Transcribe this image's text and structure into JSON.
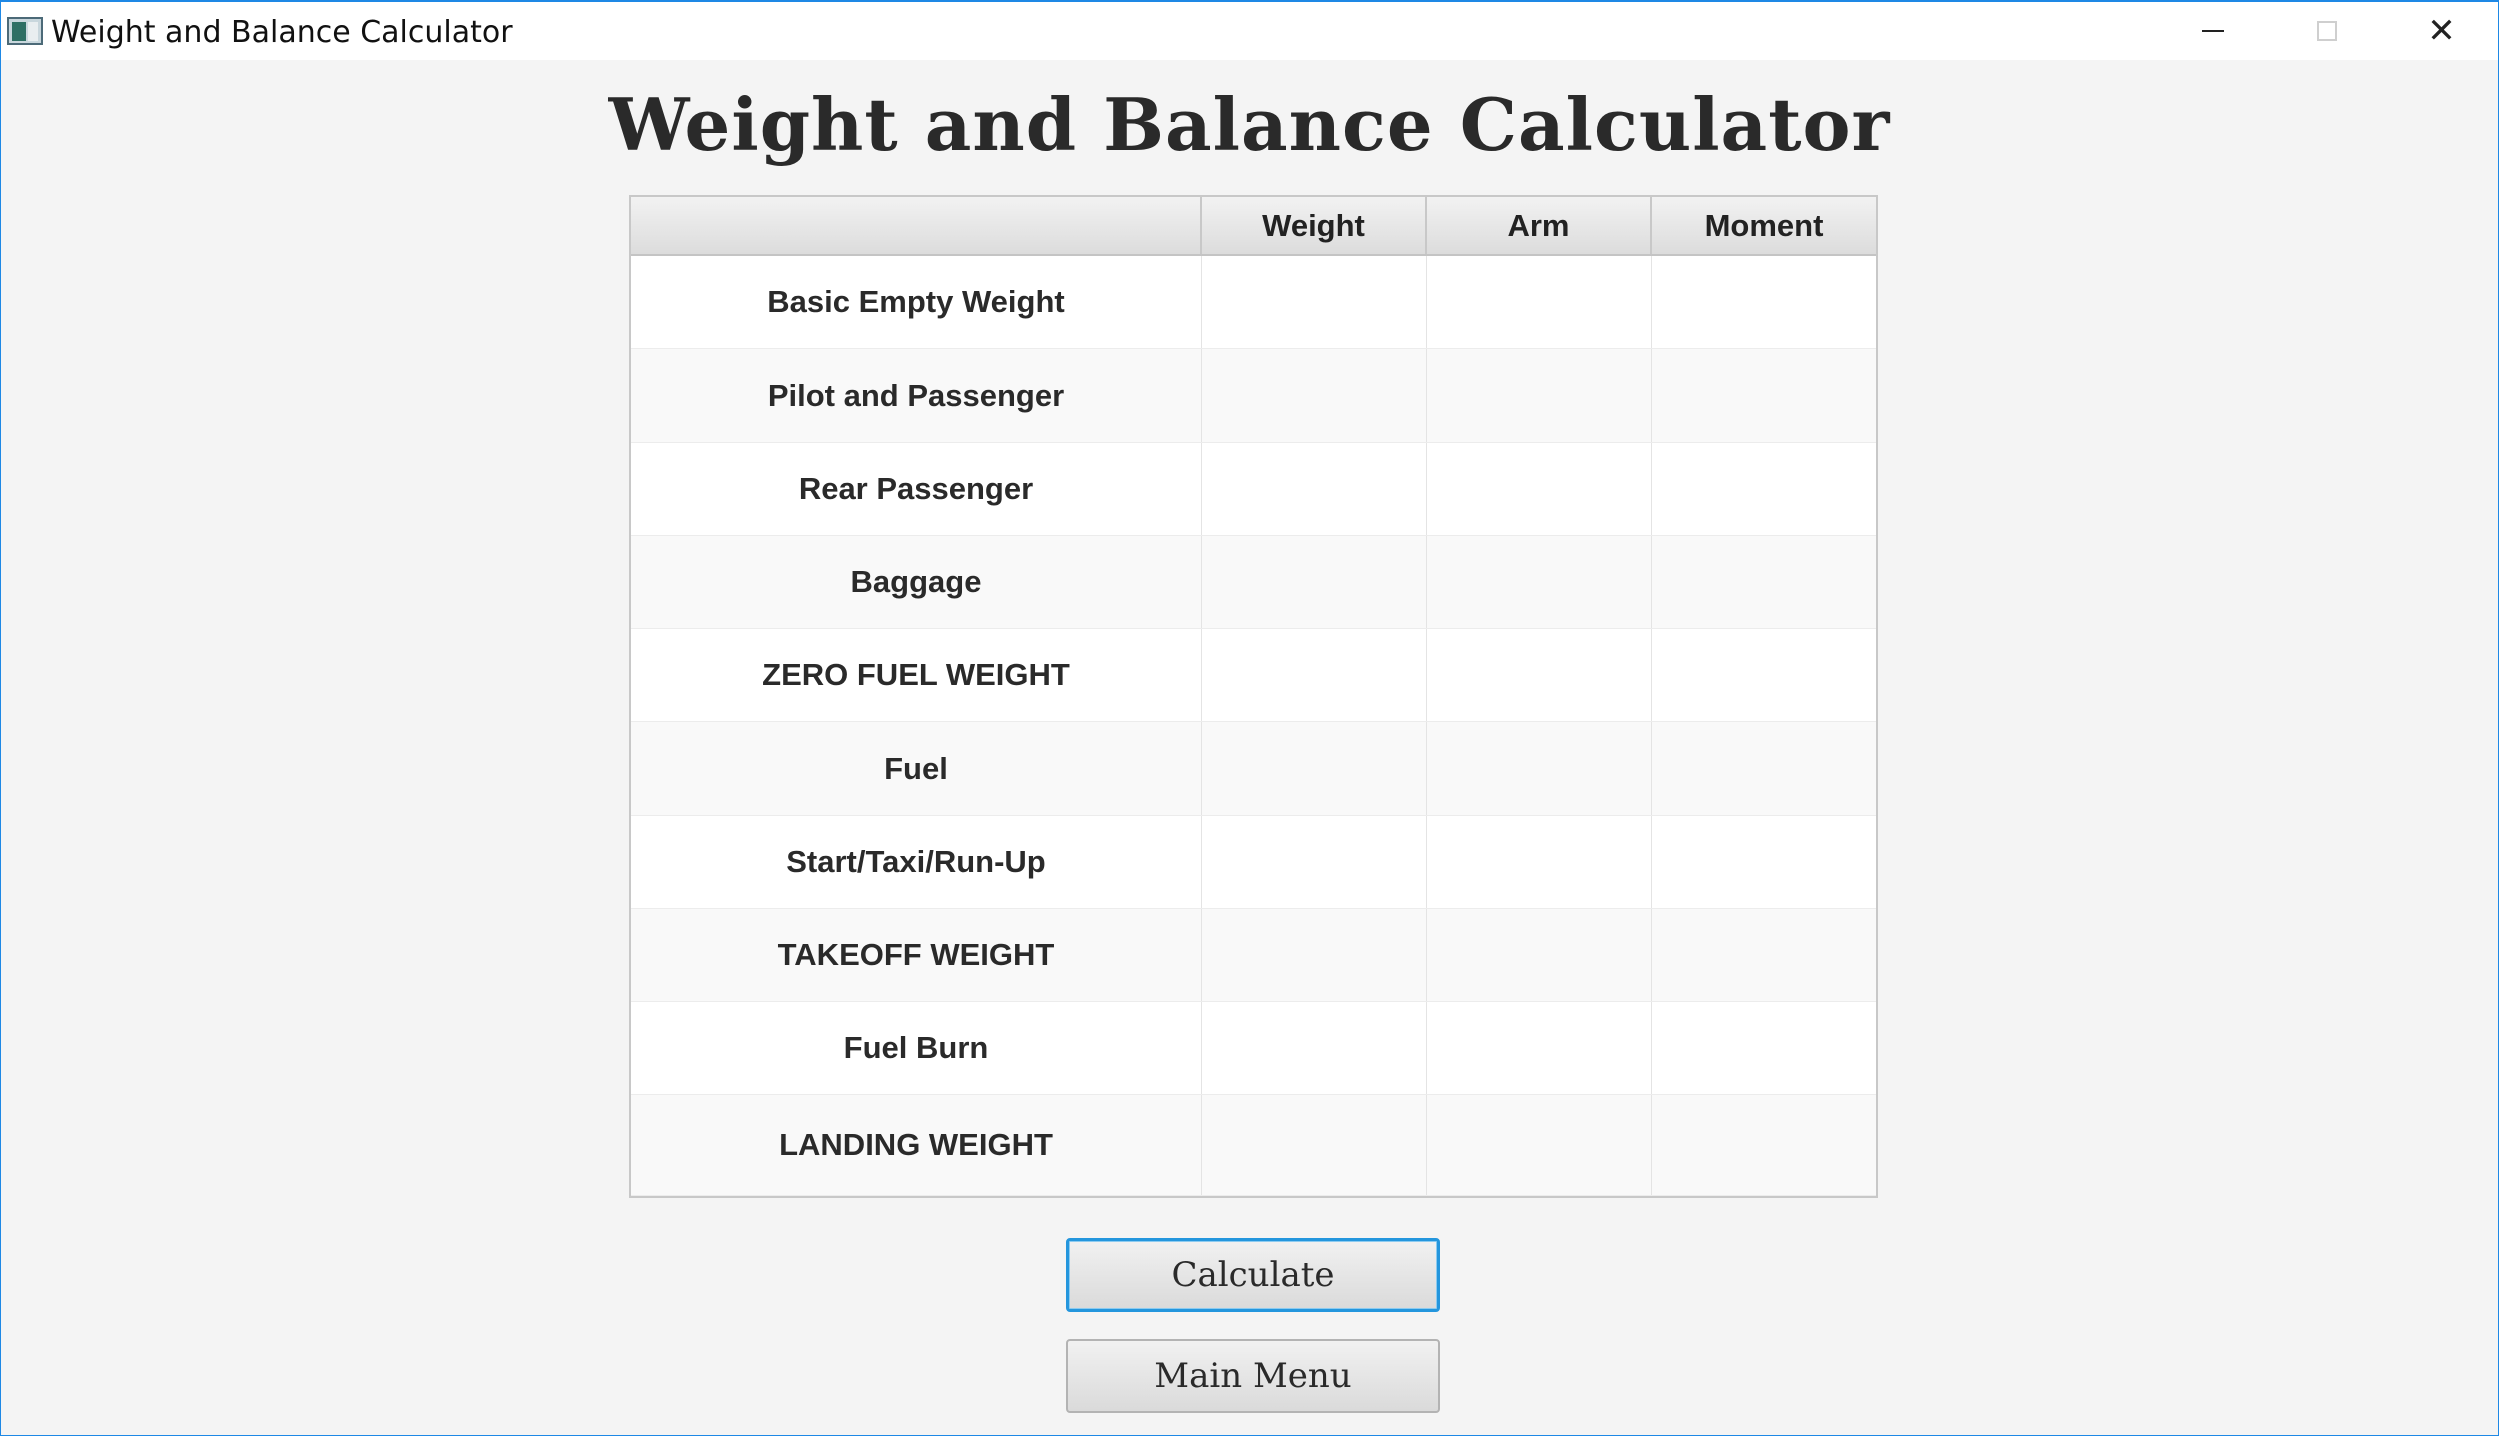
{
  "window": {
    "title": "Weight and Balance Calculator",
    "icon": "app-icon",
    "controls": {
      "minimize_icon": "minimize-icon",
      "maximize_icon": "maximize-icon",
      "close_glyph": "✕"
    }
  },
  "main": {
    "heading": "Weight and Balance Calculator"
  },
  "table": {
    "columns": [
      "",
      "Weight",
      "Arm",
      "Moment"
    ],
    "rows": [
      {
        "label": "Basic Empty Weight",
        "weight": "",
        "arm": "",
        "moment": ""
      },
      {
        "label": "Pilot and Passenger",
        "weight": "",
        "arm": "",
        "moment": ""
      },
      {
        "label": "Rear Passenger",
        "weight": "",
        "arm": "",
        "moment": ""
      },
      {
        "label": "Baggage",
        "weight": "",
        "arm": "",
        "moment": ""
      },
      {
        "label": "ZERO FUEL WEIGHT",
        "weight": "",
        "arm": "",
        "moment": ""
      },
      {
        "label": "Fuel",
        "weight": "",
        "arm": "",
        "moment": ""
      },
      {
        "label": "Start/Taxi/Run-Up",
        "weight": "",
        "arm": "",
        "moment": ""
      },
      {
        "label": "TAKEOFF WEIGHT",
        "weight": "",
        "arm": "",
        "moment": ""
      },
      {
        "label": "Fuel Burn",
        "weight": "",
        "arm": "",
        "moment": ""
      },
      {
        "label": "LANDING WEIGHT",
        "weight": "",
        "arm": "",
        "moment": ""
      }
    ]
  },
  "buttons": {
    "calculate": "Calculate",
    "main_menu": "Main Menu"
  },
  "colors": {
    "window_border": "#1e88e5",
    "focus_ring": "#2496dd",
    "background": "#f4f4f4"
  }
}
